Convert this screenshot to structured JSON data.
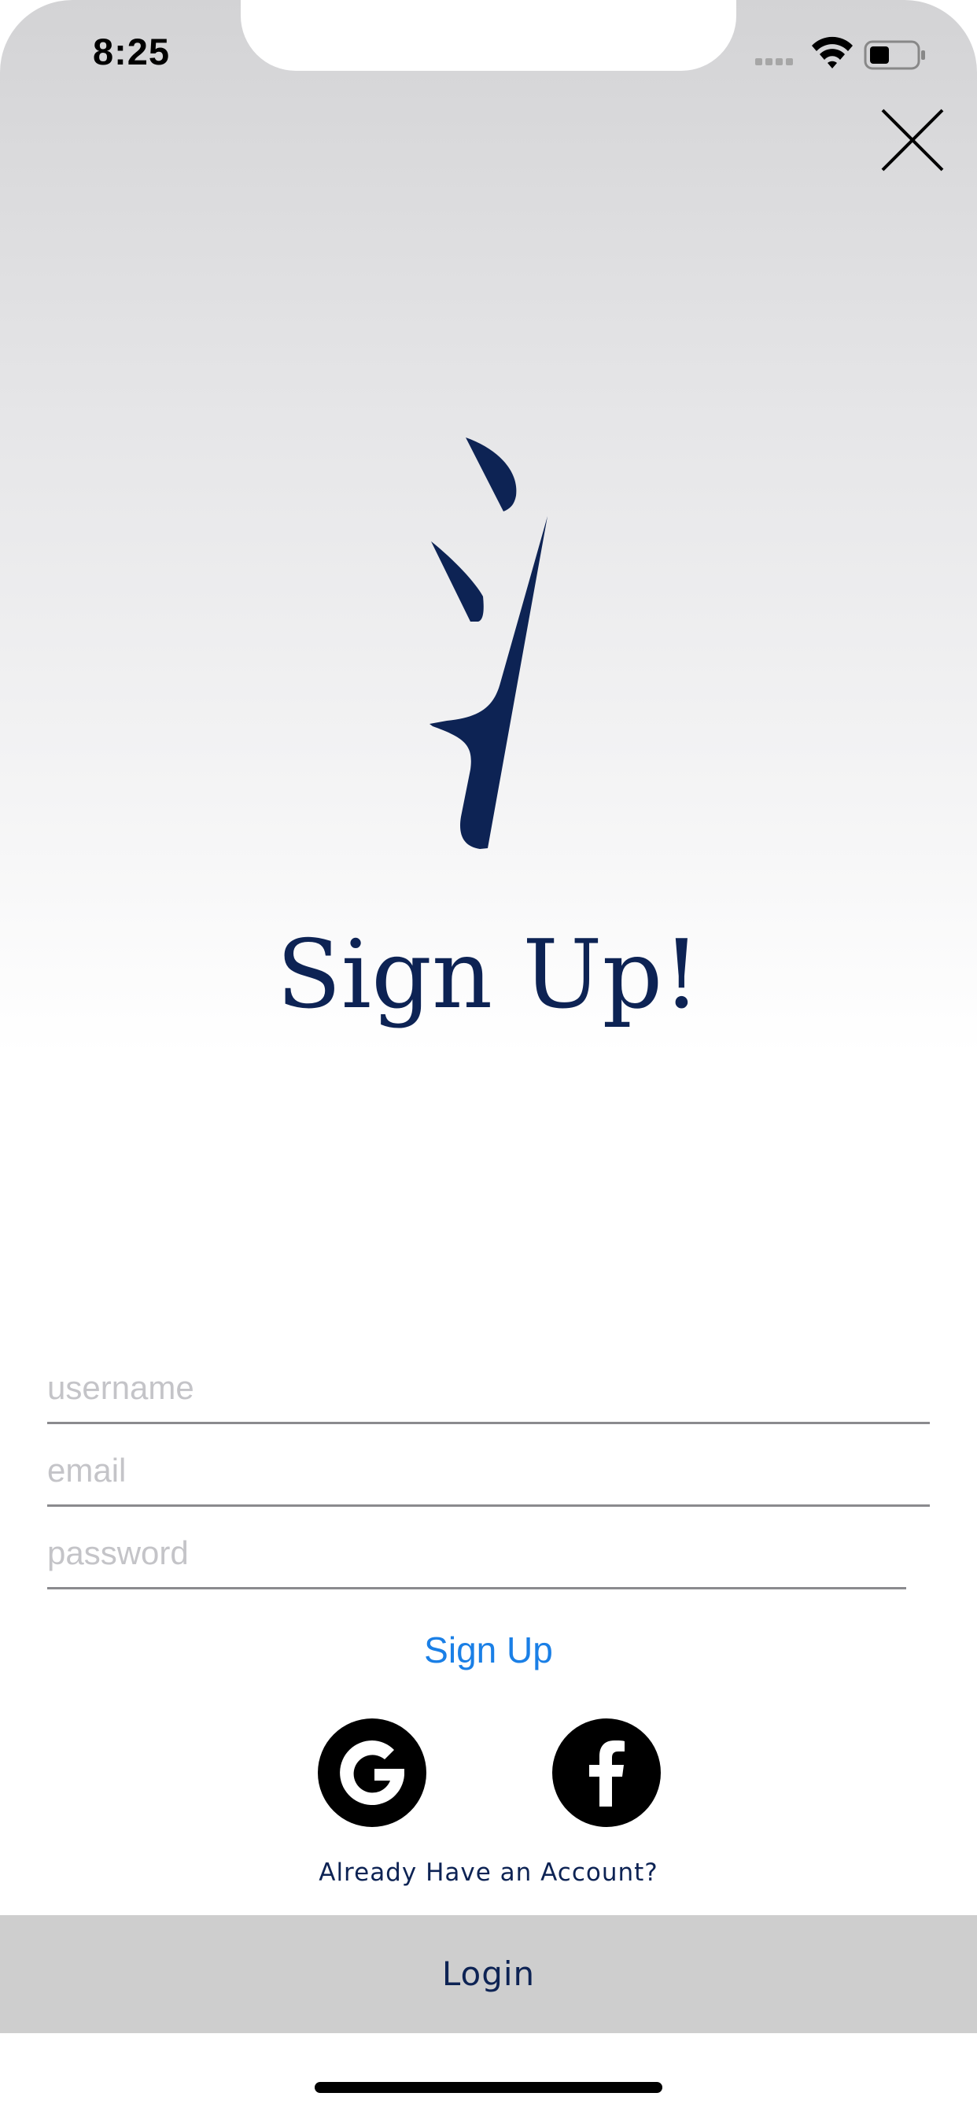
{
  "status_bar": {
    "time": "8:25"
  },
  "header": {
    "close_icon": "close-icon"
  },
  "brand": {
    "logo_icon": "brand-logo-icon",
    "logo_color": "#0d2354"
  },
  "title": "Sign Up!",
  "form": {
    "username_placeholder": "username",
    "email_placeholder": "email",
    "password_placeholder": "password",
    "signup_label": "Sign Up"
  },
  "social": {
    "google_icon": "google-icon",
    "facebook_icon": "facebook-icon"
  },
  "footer": {
    "already_text": "Already Have an Account?",
    "login_label": "Login"
  },
  "colors": {
    "accent": "#1a7fe6",
    "brand": "#0d2354",
    "login_bar": "#cecece"
  }
}
